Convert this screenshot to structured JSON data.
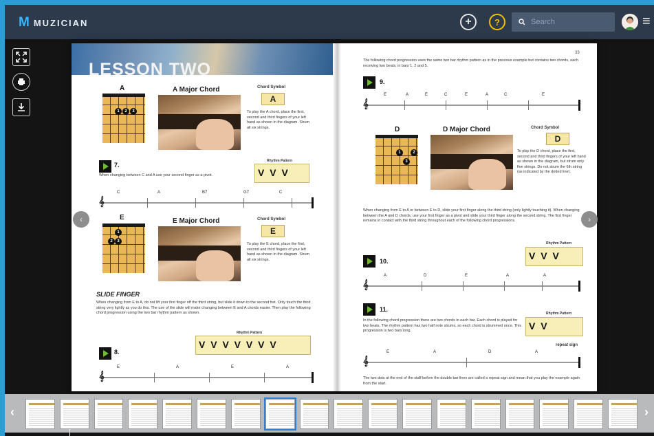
{
  "app": {
    "logo_mark": "M",
    "name": "MUZICIAN"
  },
  "header": {
    "add_icon": "plus-circle-icon",
    "help_label": "?",
    "search_placeholder": "Search",
    "search_icon": "search-icon",
    "menu_icon": "hamburger-icon"
  },
  "toolbar": {
    "fullscreen_icon": "expand-icon",
    "print_icon": "print-icon",
    "download_icon": "download-icon"
  },
  "book": {
    "left_page": {
      "title": "LESSON TWO",
      "a_chord_name": "A",
      "a_chord_title": "A Major Chord",
      "chord_symbol_label": "Chord Symbol",
      "a_symbol": "A",
      "a_desc": "To play the A chord, place the first, second and third fingers of your left hand as shown in the diagram. Strum all six strings.",
      "ex7_num": "7.",
      "ex7_text": "When changing between C and A use your second finger as a pivot.",
      "rhythm_label": "Rhythm Pattern",
      "ex7_rhythm": "V V V",
      "ex7_staff": [
        "C",
        "A",
        "B7",
        "G7",
        "C"
      ],
      "e_chord_name": "E",
      "e_chord_title": "E Major Chord",
      "e_symbol": "E",
      "e_desc": "To play the E chord, place the first, second and third fingers of your left hand as shown in the diagram. Strum all six strings.",
      "slide_title": "SLIDE FINGER",
      "slide_text": "When changing from E to A, do not lift your first finger off the third string, but slide it down to the second fret. Only touch the third string very lightly as you do this. The use of the slide will make changing between E and A chords easier. Then play the following chord progression using the two bar rhythm pattern as shown.",
      "ex8_num": "8.",
      "ex8_rhythm": "V V V V V V V",
      "ex8_staff": [
        "E",
        "A",
        "E",
        "A"
      ]
    },
    "right_page": {
      "page_number": "33",
      "intro_text": "The following chord progression uses the same two bar rhythm pattern as in the previous example but contains two chords, each receiving two beats, in bars 1, 2 and 5.",
      "ex9_num": "9.",
      "ex9_staff": [
        "E",
        "A",
        "E",
        "C",
        "E",
        "A",
        "C",
        "E"
      ],
      "d_chord_name": "D",
      "d_chord_title": "D Major Chord",
      "d_symbol": "D",
      "d_desc": "To play the D chord, place the first, second and third fingers of your left hand as shown in the diagram, but strum only five strings. Do not strum the 6th string (as indicated by the dotted line).",
      "change_text": "When changing from E to A or between E to D, slide your first finger along the third string (only lightly touching it). When changing between the A and D chords, use your first finger as a pivot and slide your third finger along the second string. The first finger remains in contact with the third string throughout each of the following chord progressions.",
      "rhythm_label": "Rhythm Pattern",
      "ex10_num": "10.",
      "ex10_rhythm": "V V V",
      "ex10_staff": [
        "A",
        "D",
        "E",
        "A",
        "A"
      ],
      "ex11_num": "11.",
      "ex11_text": "In the following chord progression there are two chords in each bar. Each chord is played for two beats. The rhythm pattern has two half note strums, so each chord is strummed once. This progression is two bars long.",
      "ex11_rhythm": "V V",
      "repeat_label": "repeat sign",
      "ex11_staff": [
        "E",
        "A",
        "D",
        "A"
      ],
      "repeat_text": "The two dots at the end of the staff before the double bar lines are called a repeat sign and mean that you play the example again from the start."
    }
  },
  "thumbnails": {
    "count": 18,
    "active_index": 7
  }
}
